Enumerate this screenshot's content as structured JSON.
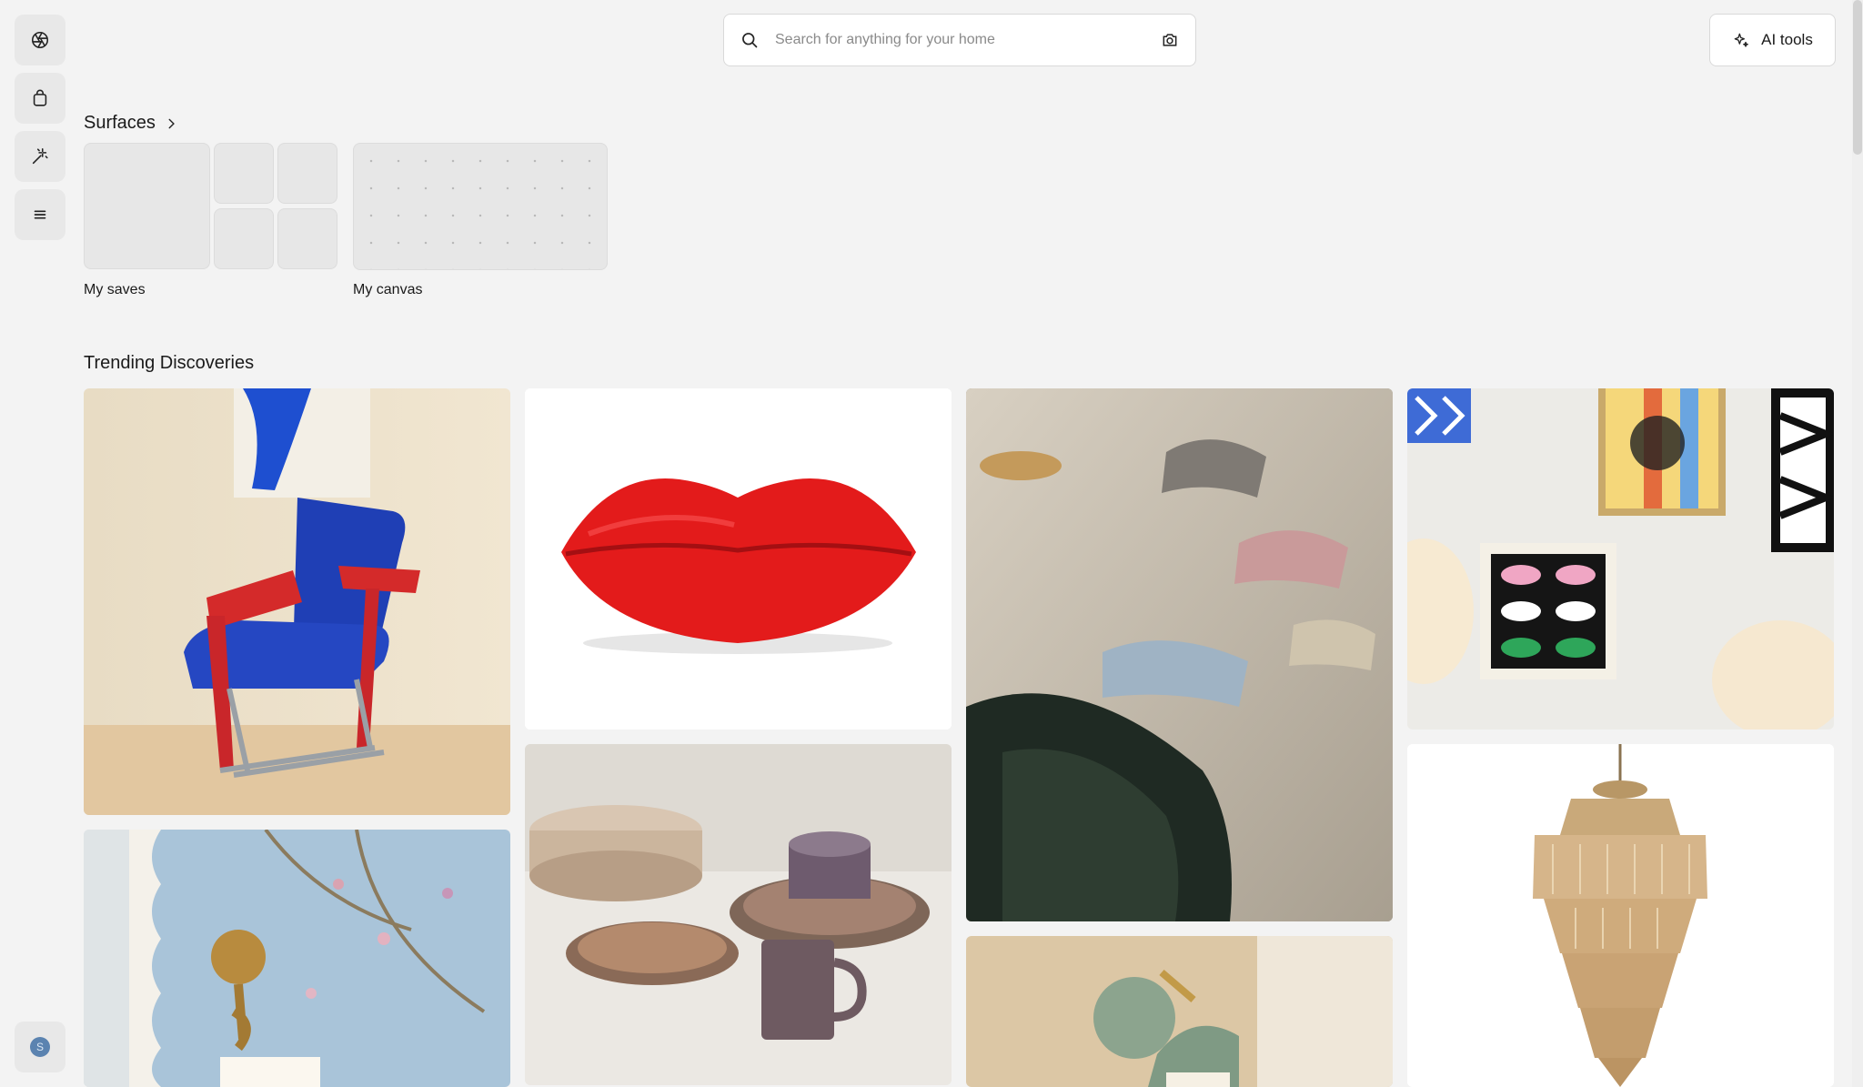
{
  "search": {
    "placeholder": "Search for anything for your home"
  },
  "header": {
    "ai_tools_label": "AI tools"
  },
  "sidebar": {
    "items": [
      {
        "icon": "aperture-icon"
      },
      {
        "icon": "shopping-bag-icon"
      },
      {
        "icon": "magic-wand-icon"
      },
      {
        "icon": "menu-icon"
      }
    ],
    "avatar_initial": "S"
  },
  "surfaces": {
    "title": "Surfaces",
    "my_saves_label": "My saves",
    "my_canvas_label": "My canvas"
  },
  "trending": {
    "title": "Trending Discoveries",
    "items": [
      {
        "subject": "blue armchair with red frame"
      },
      {
        "subject": "red lips sofa"
      },
      {
        "subject": "beige sofa with pillows"
      },
      {
        "subject": "framed art prints and paper lamps"
      },
      {
        "subject": "scalloped mirror with floral wallpaper"
      },
      {
        "subject": "ceramic dinnerware set"
      },
      {
        "subject": "wall sconce"
      },
      {
        "subject": "crystal chandelier"
      }
    ]
  },
  "colors": {
    "background": "#f3f3f3",
    "accent_avatar": "#5b83b0"
  }
}
